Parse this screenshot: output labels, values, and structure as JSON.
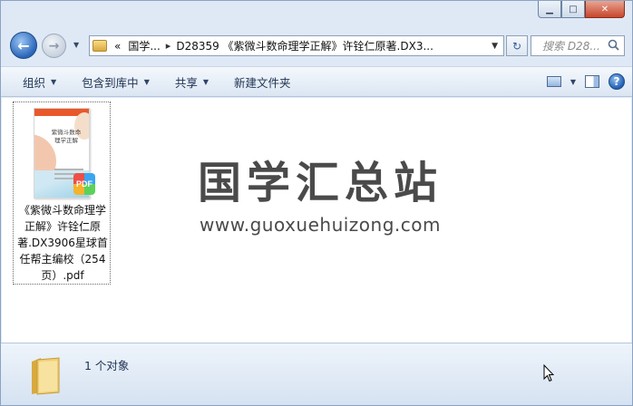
{
  "window": {
    "minimize_glyph": "▁",
    "maximize_glyph": "□",
    "close_glyph": "✕"
  },
  "nav": {
    "back_glyph": "←",
    "forward_glyph": "→",
    "recent_glyph": "▼",
    "address": {
      "prefix": "«",
      "root": "国学...",
      "path": "D28359 《紫微斗数命理学正解》许铨仁原著.DX3...",
      "dropdown_glyph": "▼"
    },
    "refresh_glyph": "↻",
    "search_placeholder": "搜索 D28..."
  },
  "toolbar": {
    "organize": "组织",
    "include_library": "包含到库中",
    "share": "共享",
    "new_folder": "新建文件夹",
    "help_glyph": "?"
  },
  "file": {
    "thumb_title": "紫微斗数命理学正解",
    "badge": "PDF",
    "name": "《紫微斗数命理学正解》许铨仁原著.DX3906星球首任帮主编校（254页）.pdf"
  },
  "watermark": {
    "title": "国学汇总站",
    "url": "www.guoxuehuizong.com"
  },
  "status": {
    "count": "1 个对象"
  },
  "colors": {
    "accent": "#2a66b8",
    "pdf_red": "#ee4e47"
  }
}
